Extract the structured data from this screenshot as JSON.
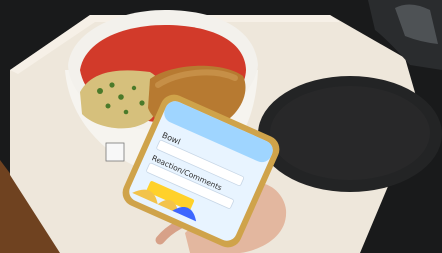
{
  "scene": {
    "phone": {
      "header_text": "",
      "field_1_label": "Bowl",
      "field_2_label": "Reaction/Comments",
      "cta_button_label": ""
    }
  },
  "colors": {
    "background_dark": "#1a1a1a",
    "tray": "#efe8dc",
    "wood": "#7a4a22",
    "bowl": "#f6f4ef",
    "tomato_soup": "#d33b28",
    "rice": "#d7c07a",
    "herbs": "#4b7a2a",
    "patty": "#b97a31",
    "lid": "#222324",
    "phone_screen": "#e8f4ff",
    "phone_header": "#9fd5ff",
    "cta_yellow": "#ffd12a"
  }
}
